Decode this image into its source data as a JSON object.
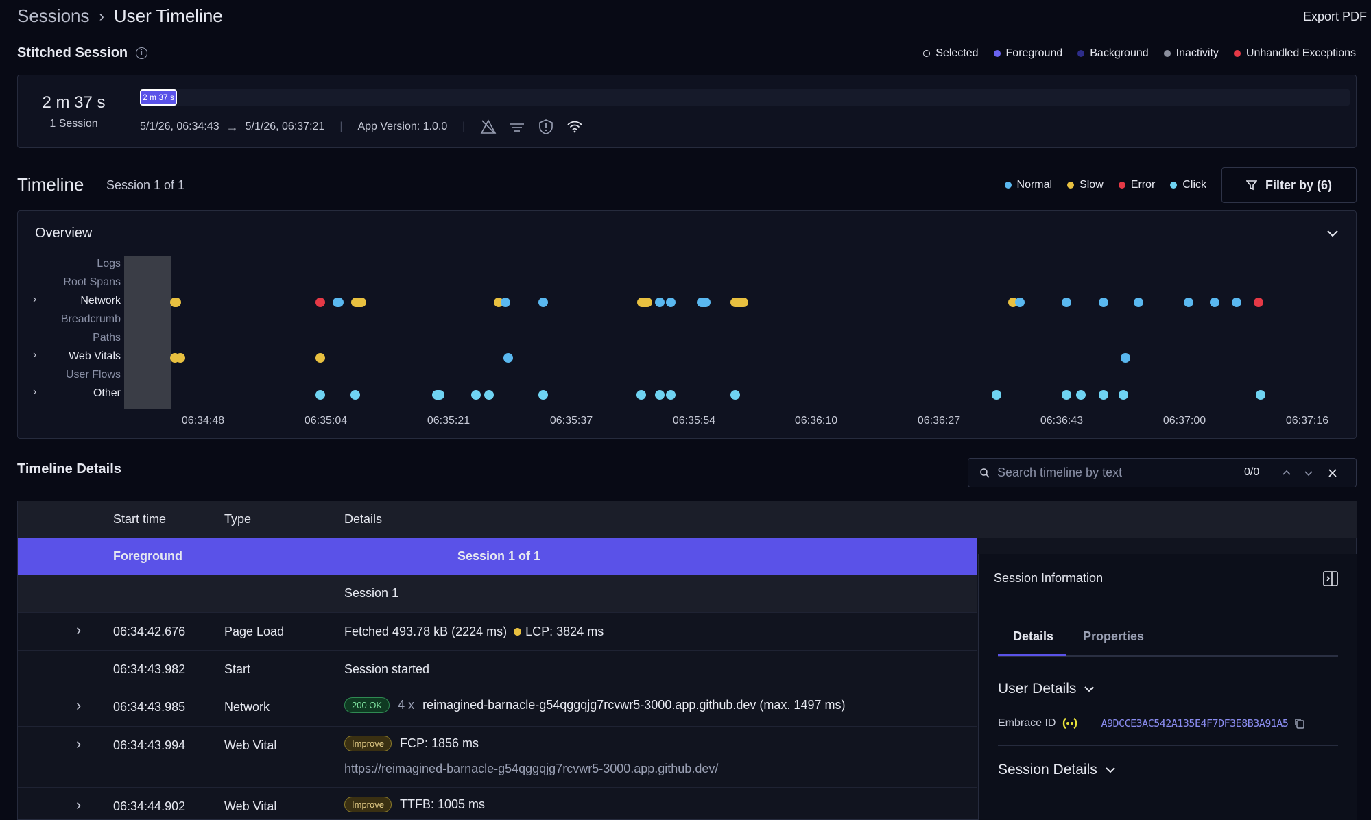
{
  "header": {
    "breadcrumb_root": "Sessions",
    "breadcrumb_sep": ">",
    "breadcrumb_current": "User Timeline",
    "export_label": "Export PDF"
  },
  "stitched": {
    "title": "Stitched Session",
    "legend": [
      "Selected",
      "Foreground",
      "Background",
      "Inactivity",
      "Unhandled Exceptions"
    ],
    "duration": "2 m 37 s",
    "session_count": "1 Session",
    "bar_label": "2 m 37 s",
    "start": "5/1/26, 06:34:43",
    "end": "5/1/26, 06:37:21",
    "app_version": "App Version: 1.0.0"
  },
  "timeline": {
    "title": "Timeline",
    "session_label": "Session 1 of 1",
    "legend": [
      "Normal",
      "Slow",
      "Error",
      "Click"
    ],
    "filter_label": "Filter by (6)"
  },
  "overview": {
    "title": "Overview",
    "rows": [
      "Logs",
      "Root Spans",
      "Network",
      "Breadcrumb",
      "Paths",
      "Web Vitals",
      "User Flows",
      "Other"
    ],
    "ticks": [
      "06:34:48",
      "06:35:04",
      "06:35:21",
      "06:35:37",
      "06:35:54",
      "06:36:10",
      "06:36:27",
      "06:36:43",
      "06:37:00",
      "06:37:16"
    ]
  },
  "details": {
    "title": "Timeline Details",
    "search_placeholder": "Search timeline by text",
    "search_count": "0/0",
    "columns": [
      "Start time",
      "Type",
      "Details"
    ],
    "foreground_label": "Foreground",
    "foreground_session": "Session 1 of 1",
    "session_row": "Session 1",
    "rows": [
      {
        "time": "06:34:42.676",
        "type": "Page Load",
        "details": "Fetched 493.78 kB (2224 ms)",
        "extra": "LCP: 3824 ms"
      },
      {
        "time": "06:34:43.982",
        "type": "Start",
        "details": "Session started"
      },
      {
        "time": "06:34:43.985",
        "type": "Network",
        "badge": "200 OK",
        "count": "4 x",
        "details": "reimagined-barnacle-g54qggqjg7rcvwr5-3000.app.github.dev (max. 1497 ms)"
      },
      {
        "time": "06:34:43.994",
        "type": "Web Vital",
        "badge": "Improve",
        "details": "FCP: 1856 ms",
        "url": "https://reimagined-barnacle-g54qggqjg7rcvwr5-3000.app.github.dev/"
      },
      {
        "time": "06:34:44.902",
        "type": "Web Vital",
        "badge": "Improve",
        "details": "TTFB: 1005 ms"
      }
    ]
  },
  "side": {
    "title": "Session Information",
    "tabs": [
      "Details",
      "Properties"
    ],
    "user_details": "User Details",
    "embrace_label": "Embrace ID",
    "embrace_value": "A9DCCE3AC542A135E4F7DF3E8B3A91A5",
    "session_details": "Session Details"
  },
  "colors": {
    "normal": "#5ab8f0",
    "slow": "#e8c040",
    "error": "#e53946",
    "click": "#6fd3f2",
    "accent": "#5a52e8"
  }
}
